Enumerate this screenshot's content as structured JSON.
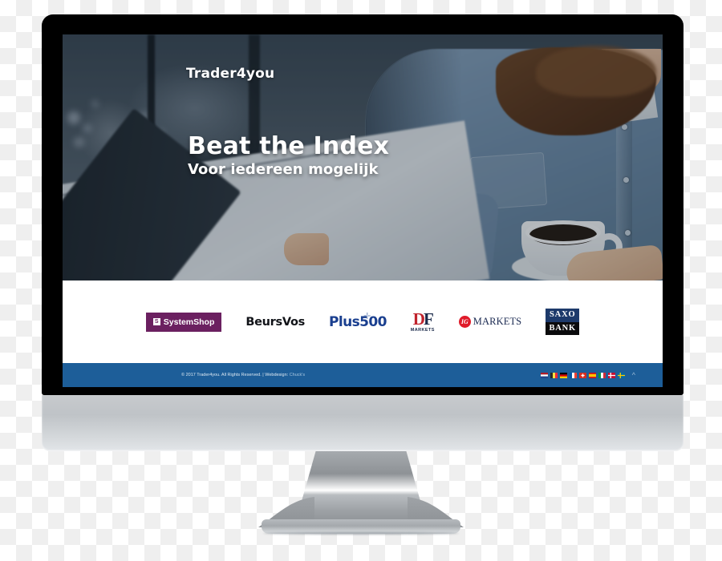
{
  "device": {
    "type": "desktop-monitor-mockup",
    "bezel_color": "#000000",
    "chin_color": "#c7cacd",
    "stand_color": "#9fa3a7"
  },
  "website": {
    "hero": {
      "logo": "Trader4you",
      "headline": "Beat the Index",
      "subheadline": "Voor iedereen mogelijk",
      "overlay_color": "#121e2c",
      "photo_description": "bearded man in denim shirt at a cafe table holding a coffee cup and a tablet"
    },
    "partners": {
      "items": [
        {
          "name": "SystemShop",
          "label": "SystemShop",
          "mark": "S",
          "style": "purple-box",
          "bg": "#6b2060",
          "fg": "#ffffff"
        },
        {
          "name": "BeursVos",
          "label": "BeursVos",
          "style": "wordmark",
          "fg": "#111318"
        },
        {
          "name": "Plus500",
          "label": "Plus500",
          "cross": "✛",
          "style": "wordmark",
          "fg": "#1a3f8f"
        },
        {
          "name": "DF Markets",
          "initial_d": "D",
          "initial_f": "F",
          "label": "MARKETS",
          "style": "monogram",
          "fg": "#1b2a4a",
          "accent": "#c0232c"
        },
        {
          "name": "IG Markets",
          "badge": "IG",
          "label": "MARKETS",
          "style": "circle-badge",
          "badge_bg": "#e01b2a",
          "fg": "#1b2a52"
        },
        {
          "name": "Saxo Bank",
          "line1": "SAXO",
          "line2": "BANK",
          "style": "two-tone-box",
          "bg_top": "#1d3a6b",
          "bg_bottom": "#0b0b0d",
          "fg": "#ffffff"
        }
      ]
    },
    "footer": {
      "background": "#1d5e99",
      "copyright": "© 2017 Trader4you. All Rights Reserved. | Webdesign: ",
      "webdesign_credit": "Chuck's",
      "scroll_top_icon": "chevron-up-icon",
      "languages": [
        {
          "code": "nl",
          "name": "Netherlands"
        },
        {
          "code": "be",
          "name": "Belgium"
        },
        {
          "code": "de",
          "name": "Germany"
        },
        {
          "code": "fr",
          "name": "France"
        },
        {
          "code": "ch",
          "name": "Switzerland"
        },
        {
          "code": "es",
          "name": "Spain"
        },
        {
          "code": "it",
          "name": "Italy"
        },
        {
          "code": "dk",
          "name": "Denmark"
        },
        {
          "code": "se",
          "name": "Sweden"
        }
      ]
    }
  }
}
